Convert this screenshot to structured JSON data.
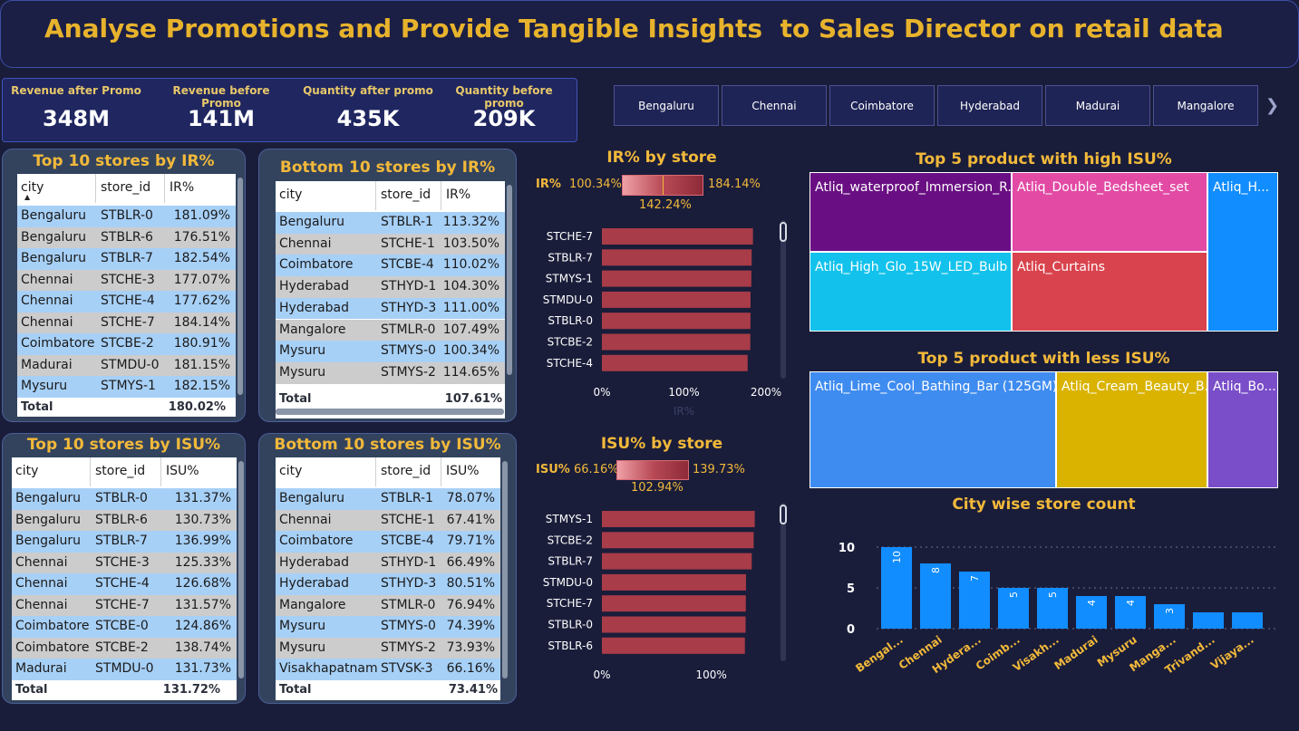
{
  "header": {
    "title": "Analyse Promotions and Provide Tangible Insights  to Sales Director on retail data"
  },
  "kpis": [
    {
      "label": "Revenue after Promo",
      "value": "348M"
    },
    {
      "label": "Revenue before Promo",
      "value": "141M"
    },
    {
      "label": "Quantity after promo",
      "value": "435K"
    },
    {
      "label": "Quantity before promo",
      "value": "209K"
    }
  ],
  "slicer": {
    "cities": [
      "Bengaluru",
      "Chennai",
      "Coimbatore",
      "Hyderabad",
      "Madurai",
      "Mangalore"
    ],
    "next_icon": "chevron-right-icon"
  },
  "tables": {
    "top_ir": {
      "title": "Top 10 stores by IR%",
      "columns": [
        "city",
        "store_id",
        "IR%"
      ],
      "rows": [
        [
          "Bengaluru",
          "STBLR-0",
          "181.09%"
        ],
        [
          "Bengaluru",
          "STBLR-6",
          "176.51%"
        ],
        [
          "Bengaluru",
          "STBLR-7",
          "182.54%"
        ],
        [
          "Chennai",
          "STCHE-3",
          "177.07%"
        ],
        [
          "Chennai",
          "STCHE-4",
          "177.62%"
        ],
        [
          "Chennai",
          "STCHE-7",
          "184.14%"
        ],
        [
          "Coimbatore",
          "STCBE-2",
          "180.91%"
        ],
        [
          "Madurai",
          "STMDU-0",
          "181.15%"
        ],
        [
          "Mysuru",
          "STMYS-1",
          "182.15%"
        ]
      ],
      "total_label": "Total",
      "total_value": "180.02%"
    },
    "bottom_ir": {
      "title": "Bottom 10 stores by IR%",
      "columns": [
        "city",
        "store_id",
        "IR%"
      ],
      "rows": [
        [
          "Bengaluru",
          "STBLR-1",
          "113.32%"
        ],
        [
          "Chennai",
          "STCHE-1",
          "103.50%"
        ],
        [
          "Coimbatore",
          "STCBE-4",
          "110.02%"
        ],
        [
          "Hyderabad",
          "STHYD-1",
          "104.30%"
        ],
        [
          "Hyderabad",
          "STHYD-3",
          "111.00%"
        ],
        [
          "Mangalore",
          "STMLR-0",
          "107.49%"
        ],
        [
          "Mysuru",
          "STMYS-0",
          "100.34%"
        ],
        [
          "Mysuru",
          "STMYS-2",
          "114.65%"
        ]
      ],
      "total_label": "Total",
      "total_value": "107.61%"
    },
    "top_isu": {
      "title": "Top 10 stores by ISU%",
      "columns": [
        "city",
        "store_id",
        "ISU%"
      ],
      "rows": [
        [
          "Bengaluru",
          "STBLR-0",
          "131.37%"
        ],
        [
          "Bengaluru",
          "STBLR-6",
          "130.73%"
        ],
        [
          "Bengaluru",
          "STBLR-7",
          "136.99%"
        ],
        [
          "Chennai",
          "STCHE-3",
          "125.33%"
        ],
        [
          "Chennai",
          "STCHE-4",
          "126.68%"
        ],
        [
          "Chennai",
          "STCHE-7",
          "131.57%"
        ],
        [
          "Coimbatore",
          "STCBE-0",
          "124.86%"
        ],
        [
          "Coimbatore",
          "STCBE-2",
          "138.74%"
        ],
        [
          "Madurai",
          "STMDU-0",
          "131.73%"
        ]
      ],
      "total_label": "Total",
      "total_value": "131.72%"
    },
    "bottom_isu": {
      "title": "Bottom 10 stores by ISU%",
      "columns": [
        "city",
        "store_id",
        "ISU%"
      ],
      "rows": [
        [
          "Bengaluru",
          "STBLR-1",
          "78.07%"
        ],
        [
          "Chennai",
          "STCHE-1",
          "67.41%"
        ],
        [
          "Coimbatore",
          "STCBE-4",
          "79.71%"
        ],
        [
          "Hyderabad",
          "STHYD-1",
          "66.49%"
        ],
        [
          "Hyderabad",
          "STHYD-3",
          "80.51%"
        ],
        [
          "Mangalore",
          "STMLR-0",
          "76.94%"
        ],
        [
          "Mysuru",
          "STMYS-0",
          "74.39%"
        ],
        [
          "Mysuru",
          "STMYS-2",
          "73.93%"
        ],
        [
          "Visakhapatnam",
          "STVSK-3",
          "66.16%"
        ]
      ],
      "total_label": "Total",
      "total_value": "73.41%"
    }
  },
  "legends": {
    "ir": {
      "label": "IR%",
      "min": "100.34%",
      "max": "184.14%",
      "mid": "142.24%"
    },
    "isu": {
      "label": "ISU%",
      "min": "66.16%",
      "max": "139.73%",
      "mid": "102.94%"
    }
  },
  "treemaps": {
    "high": {
      "title": "Top 5 product with high ISU%",
      "items": [
        {
          "label": "Atliq_waterproof_Immersion_R...",
          "color": "#6a0f83"
        },
        {
          "label": "Atliq_Double_Bedsheet_set",
          "color": "#e24aa4"
        },
        {
          "label": "Atliq_H...",
          "color": "#118dff"
        },
        {
          "label": "Atliq_High_Glo_15W_LED_Bulb",
          "color": "#12c2ec"
        },
        {
          "label": "Atliq_Curtains",
          "color": "#d9434d"
        }
      ]
    },
    "low": {
      "title": "Top 5 product with less ISU%",
      "items": [
        {
          "label": "Atliq_Lime_Cool_Bathing_Bar (125GM)",
          "color": "#3f8cf0"
        },
        {
          "label": "Atliq_Cream_Beauty_B...",
          "color": "#d9b300"
        },
        {
          "label": "Atliq_Bo...",
          "color": "#7a4ec9"
        }
      ]
    }
  },
  "chart_data": [
    {
      "type": "bar",
      "orientation": "horizontal",
      "title": "IR% by store",
      "xlabel": "IR%",
      "categories": [
        "STCHE-7",
        "STBLR-7",
        "STMYS-1",
        "STMDU-0",
        "STBLR-0",
        "STCBE-2",
        "STCHE-4"
      ],
      "values": [
        184.14,
        182.54,
        182.15,
        181.15,
        181.09,
        180.91,
        177.62
      ],
      "xlim": [
        0,
        200
      ],
      "x_ticks": [
        "0%",
        "100%",
        "200%"
      ],
      "bar_color": "#a83c48"
    },
    {
      "type": "bar",
      "orientation": "horizontal",
      "title": "ISU% by store",
      "categories": [
        "STMYS-1",
        "STCBE-2",
        "STBLR-7",
        "STMDU-0",
        "STCHE-7",
        "STBLR-0",
        "STBLR-6"
      ],
      "values": [
        139.73,
        138.74,
        136.99,
        131.73,
        131.57,
        131.37,
        130.73
      ],
      "xlim": [
        0,
        150
      ],
      "x_ticks": [
        "0%",
        "100%"
      ],
      "bar_color": "#a83c48"
    },
    {
      "type": "bar",
      "title": "City wise store count",
      "categories": [
        "Bengal...",
        "Chennai",
        "Hydera...",
        "Coimb...",
        "Visakh...",
        "Madurai",
        "Mysuru",
        "Manga...",
        "Trivand...",
        "Vijaya..."
      ],
      "values": [
        10,
        8,
        7,
        5,
        5,
        4,
        4,
        3,
        2,
        2
      ],
      "data_labels": [
        "10",
        "8",
        "7",
        "5",
        "5",
        "4",
        "4",
        "3",
        "",
        ""
      ],
      "ylim": [
        0,
        10
      ],
      "y_ticks": [
        "0",
        "5",
        "10"
      ],
      "bar_color": "#118dff"
    }
  ]
}
